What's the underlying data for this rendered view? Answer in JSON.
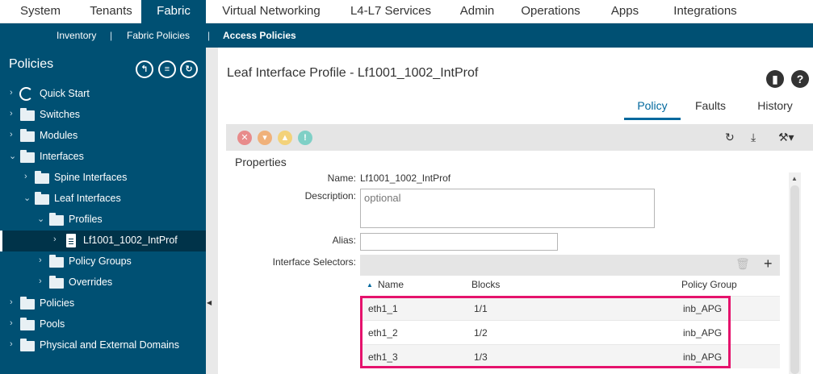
{
  "top_tabs": [
    {
      "label": "System"
    },
    {
      "label": "Tenants"
    },
    {
      "label": "Fabric",
      "active": true
    },
    {
      "label": "Virtual Networking"
    },
    {
      "label": "L4-L7 Services"
    },
    {
      "label": "Admin"
    },
    {
      "label": "Operations"
    },
    {
      "label": "Apps"
    },
    {
      "label": "Integrations"
    }
  ],
  "sub_tabs": [
    {
      "label": "Inventory"
    },
    {
      "label": "Fabric Policies"
    },
    {
      "label": "Access Policies",
      "active": true
    }
  ],
  "sub_separator": "|",
  "sidebar": {
    "title": "Policies",
    "tree": [
      {
        "label": "Quick Start",
        "icon": "quick-start-icon"
      },
      {
        "label": "Switches",
        "icon": "folder-icon"
      },
      {
        "label": "Modules",
        "icon": "folder-icon"
      },
      {
        "label": "Interfaces",
        "icon": "folder-icon",
        "expanded": true
      },
      {
        "label": "Spine Interfaces",
        "icon": "folder-icon"
      },
      {
        "label": "Leaf Interfaces",
        "icon": "folder-icon",
        "expanded": true
      },
      {
        "label": "Profiles",
        "icon": "folder-icon",
        "expanded": true
      },
      {
        "label": "Lf1001_1002_IntProf",
        "icon": "document-icon",
        "selected": true
      },
      {
        "label": "Policy Groups",
        "icon": "folder-icon"
      },
      {
        "label": "Overrides",
        "icon": "folder-icon"
      },
      {
        "label": "Policies",
        "icon": "folder-icon"
      },
      {
        "label": "Pools",
        "icon": "folder-icon"
      },
      {
        "label": "Physical and External Domains",
        "icon": "folder-icon"
      }
    ]
  },
  "main": {
    "title": "Leaf Interface Profile - Lf1001_1002_IntProf",
    "tabs": [
      {
        "label": "Policy",
        "active": true
      },
      {
        "label": "Faults"
      },
      {
        "label": "History"
      }
    ],
    "properties_heading": "Properties",
    "fields": {
      "name_label": "Name:",
      "name_value": "Lf1001_1002_IntProf",
      "description_label": "Description:",
      "description_placeholder": "optional",
      "alias_label": "Alias:",
      "selectors_label": "Interface Selectors:"
    },
    "table": {
      "headers": [
        "Name",
        "Blocks",
        "Policy Group"
      ],
      "rows": [
        {
          "name": "eth1_1",
          "blocks": "1/1",
          "policy_group": "inb_APG"
        },
        {
          "name": "eth1_2",
          "blocks": "1/2",
          "policy_group": "inb_APG"
        },
        {
          "name": "eth1_3",
          "blocks": "1/3",
          "policy_group": "inb_APG"
        }
      ]
    }
  },
  "colors": {
    "brand": "#005073",
    "accent": "#00689d",
    "highlight": "#e5126c",
    "fault_critical": "#e88b8b",
    "fault_major": "#f0b17a",
    "fault_minor": "#f3d27a",
    "fault_warning": "#7fd0c6"
  }
}
